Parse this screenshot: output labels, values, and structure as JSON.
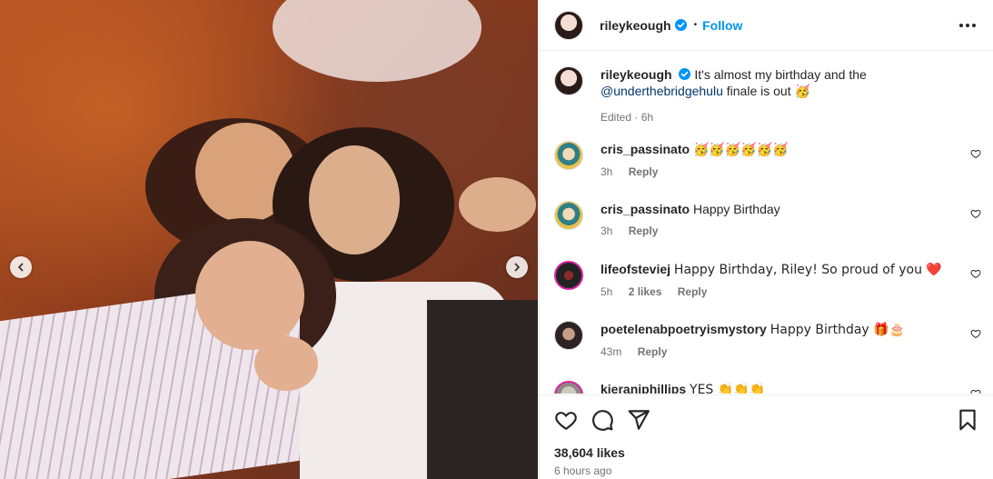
{
  "post": {
    "username": "rileykeough",
    "follow_label": "Follow",
    "separator": "•",
    "caption_text": "It's almost my birthday and the",
    "caption_mention": "@underthebridgehulu",
    "caption_tail": "finale is out",
    "caption_emoji": "🥳",
    "edited_label": "Edited · 6h"
  },
  "comments": [
    {
      "user": "cris_passinato",
      "text": "🥳🥳🥳🥳🥳🥳",
      "time": "3h",
      "likes": "",
      "reply": "Reply"
    },
    {
      "user": "cris_passinato",
      "text": "Happy Birthday",
      "time": "3h",
      "likes": "",
      "reply": "Reply"
    },
    {
      "user": "lifeofsteviej",
      "text": "Happy Birthday, Riley! So proud of you ❤️",
      "time": "5h",
      "likes": "2 likes",
      "reply": "Reply"
    },
    {
      "user": "poetelenabpoetryismystory",
      "text": "Happy Birthday 🎁🎂",
      "time": "43m",
      "likes": "",
      "reply": "Reply"
    },
    {
      "user": "kieranjphillips",
      "text": "YES 👏👏👏",
      "time": "",
      "likes": "",
      "reply": ""
    }
  ],
  "footer": {
    "likes": "38,604 likes",
    "timestamp": "6 hours ago"
  },
  "icons": {
    "verified": "verified-badge-icon",
    "like": "heart-icon",
    "comment": "comment-icon",
    "share": "share-icon",
    "save": "bookmark-icon",
    "more": "more-options-icon",
    "prev": "chevron-left-icon",
    "next": "chevron-right-icon"
  },
  "colors": {
    "accent": "#0095f6",
    "mention": "#00376b",
    "muted": "#737373",
    "story_ring": "#d6249f"
  }
}
